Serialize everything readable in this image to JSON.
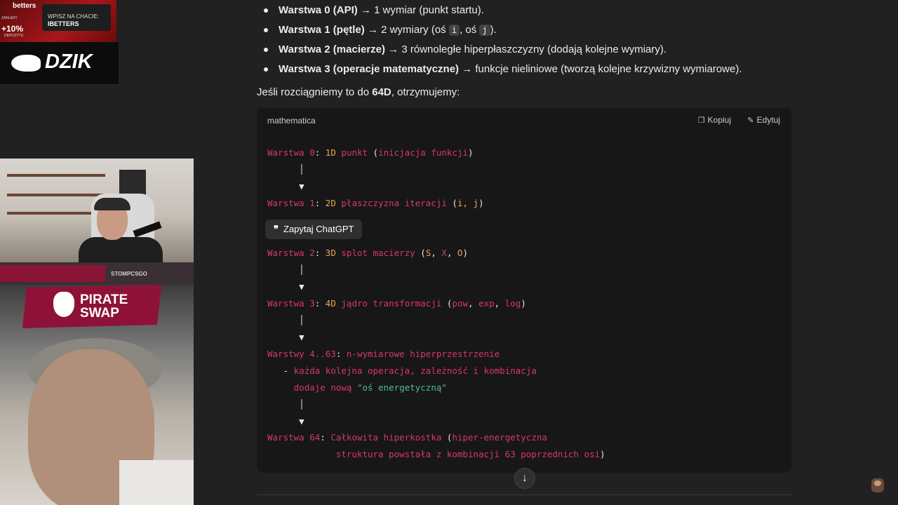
{
  "bullets": [
    {
      "bold": "Warstwa 0 (API)",
      "rest": " → 1 wymiar (punkt startu)."
    },
    {
      "bold": "Warstwa 1 (pętle)",
      "rest1": " → 2 wymiary (oś ",
      "code1": "i",
      "rest2": ", oś ",
      "code2": "j",
      "rest3": ")."
    },
    {
      "bold": "Warstwa 2 (macierze)",
      "rest": " → 3 równoległe hiperpłaszczyzny (dodają kolejne wymiary)."
    },
    {
      "bold": "Warstwa 3 (operacje matematyczne)",
      "rest": " → funkcje nieliniowe (tworzą kolejne krzywizny wymiarowe)."
    }
  ],
  "lead": {
    "pre": "Jeśli rozciągniemy to do ",
    "bold": "64D",
    "post": ", otrzymujemy:"
  },
  "code_block": {
    "language": "mathematica",
    "copy_label": "Kopiuj",
    "edit_label": "Edytuj",
    "lines": {
      "l1": {
        "k": "Warstwa 0",
        "n": "1D",
        "a": "punkt",
        "b": "inicjacja funkcji"
      },
      "l2": {
        "k": "Warstwa 1",
        "n": "2D",
        "a": "płaszczyzna iteracji",
        "b": "i, j"
      },
      "l3": {
        "k": "Warstwa 2",
        "n": "3D",
        "a": "splot macierzy",
        "b1": "S",
        "b2": "X",
        "b3": "O"
      },
      "l4": {
        "k": "Warstwa 3",
        "n": "4D",
        "a": "jądro transformacji",
        "b1": "pow",
        "b2": "exp",
        "b3": "log"
      },
      "l5": {
        "k": "Warstwy 4..63",
        "a": "n-wymiarowe hiperprzestrzenie"
      },
      "l6": {
        "a": "każda kolejna operacja, zależność i kombinacja"
      },
      "l7": {
        "a": "dodaje nową",
        "g": "\"oś energetyczną\""
      },
      "l8": {
        "k": "Warstwa 64",
        "a": "Całkowita hiperkostka",
        "b": "hiper-energetyczna"
      },
      "l9": {
        "a": "struktura powstała z kombinacji 63 poprzednich osi"
      }
    }
  },
  "tooltip": {
    "icon": "❞",
    "label": "Zapytaj ChatGPT"
  },
  "scroll_button": {
    "icon": "↓"
  },
  "overlay": {
    "betters_brand": "betters",
    "betters_promo": "WPISZ NA CHACIE:",
    "betters_code": "IBETTERS",
    "betters_pct": "+10%",
    "betters_small": "ZAKŁADY",
    "betters_small2": "DEPOZYTU",
    "dzik": "DZIK",
    "stomp_handle": "STOMPCSGO",
    "pirate_line1": "PIRATE",
    "pirate_line2": "SWAP"
  },
  "colors": {
    "background": "#212121",
    "code_bg": "#171717",
    "keyword": "#d7376d",
    "number": "#f0a552",
    "string": "#4fbf8f"
  }
}
